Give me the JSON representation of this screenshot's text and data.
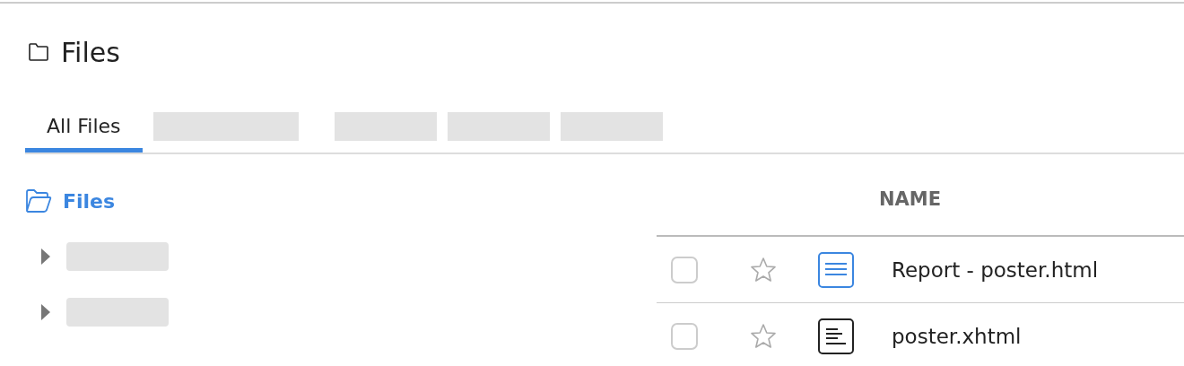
{
  "header": {
    "title": "Files"
  },
  "tabs": [
    {
      "kind": "text",
      "label": "All Files",
      "selected": true
    },
    {
      "kind": "redacted",
      "selected": false
    },
    {
      "kind": "redacted",
      "selected": false
    },
    {
      "kind": "redacted",
      "selected": false
    },
    {
      "kind": "redacted",
      "selected": false
    }
  ],
  "tree": {
    "root": {
      "label": "Files",
      "selected": true
    },
    "children": [
      {
        "kind": "redacted",
        "expanded": false
      },
      {
        "kind": "redacted",
        "expanded": false
      }
    ]
  },
  "table": {
    "columns": [
      "NAME"
    ],
    "rows": [
      {
        "checked": false,
        "starred": false,
        "kind": "lines",
        "name": "Report - poster.html"
      },
      {
        "checked": false,
        "starred": false,
        "kind": "text",
        "name": "poster.xhtml"
      }
    ]
  }
}
